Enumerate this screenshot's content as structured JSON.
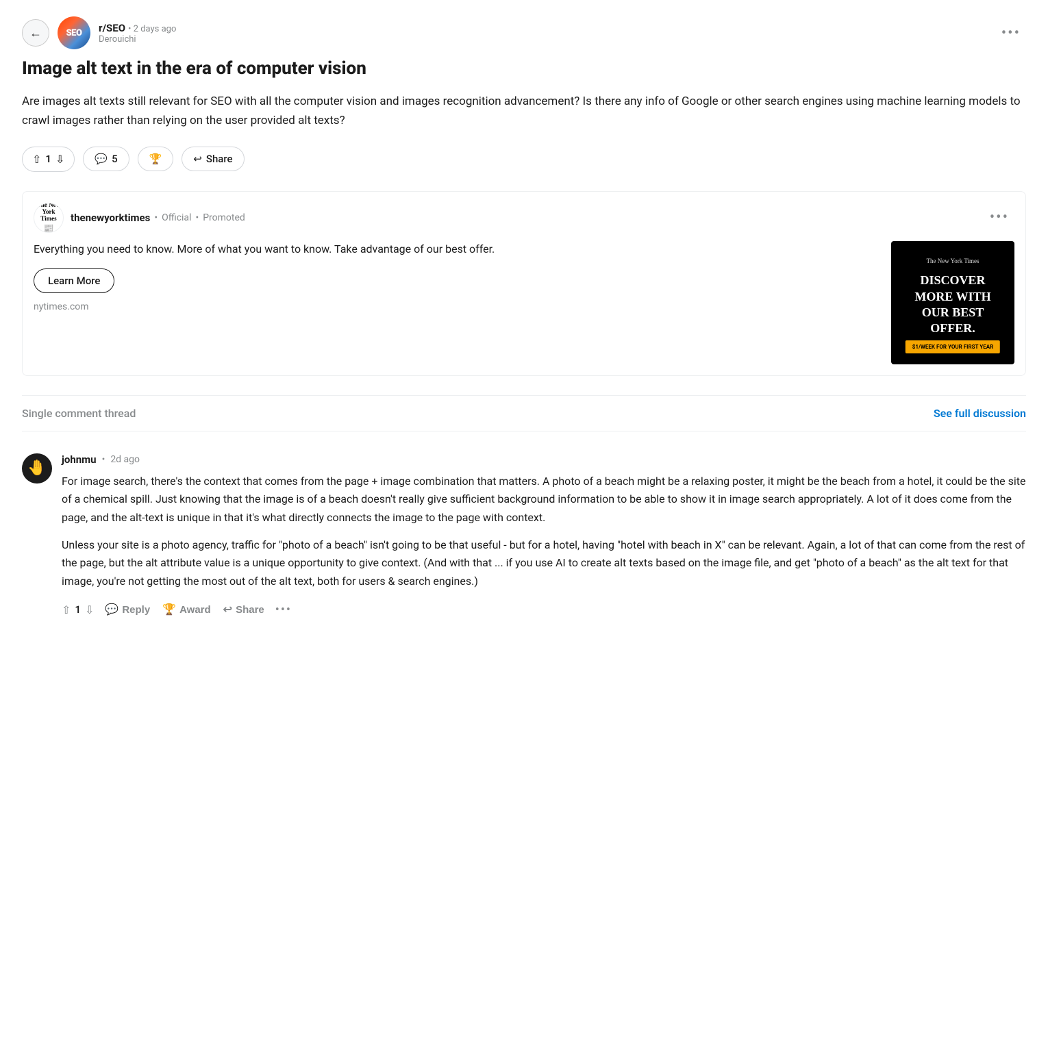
{
  "back_button": "←",
  "subreddit": {
    "name": "r/SEO",
    "avatar_text": "SEO",
    "time": "2 days ago",
    "author": "Derouichi"
  },
  "post": {
    "title": "Image alt text in the era of computer vision",
    "body": "Are images alt texts still relevant for SEO with all the computer vision and images recognition advancement? Is there any info of Google or other search engines using machine learning models to crawl images rather than relying on the user provided alt texts?"
  },
  "actions": {
    "vote_count": "1",
    "comment_count": "5",
    "share_label": "Share",
    "award_icon": "🏆"
  },
  "ad": {
    "advertiser": "thenewyorktimes",
    "official_label": "Official",
    "promoted_label": "Promoted",
    "description": "Everything you need to know. More of what you want to know. Take advantage of our best offer.",
    "learn_more": "Learn More",
    "domain": "nytimes.com",
    "image_nyt_header": "The New York Times",
    "image_headline": "DISCOVER MORE WITH OUR BEST OFFER.",
    "image_cta": "$1/WEEK FOR YOUR FIRST YEAR"
  },
  "thread": {
    "single_label": "Single comment thread",
    "see_full": "See full discussion"
  },
  "comment": {
    "username": "johnmu",
    "time": "2d ago",
    "body_p1": "For image search, there's the context that comes from the page + image combination that matters. A photo of a beach might be a relaxing poster, it might be the beach from a hotel, it could be the site of a chemical spill. Just knowing that the image is of a beach doesn't really give sufficient background information to be able to show it in image search appropriately. A lot of it does come from the page, and the alt-text is unique in that it's what directly connects the image to the page with context.",
    "body_p2": "Unless your site is a photo agency, traffic for \"photo of a beach\" isn't going to be that useful - but for a hotel, having \"hotel with beach in X\" can be relevant. Again, a lot of that can come from the rest of the page, but the alt attribute value is a unique opportunity to give context. (And with that ... if you use AI to create alt texts based on the image file, and get \"photo of a beach\" as the alt text for that image, you're not getting the most out of the alt text, both for users & search engines.)",
    "vote_count": "1",
    "reply_label": "Reply",
    "award_label": "Award",
    "share_label": "Share"
  },
  "more_options_label": "•••"
}
